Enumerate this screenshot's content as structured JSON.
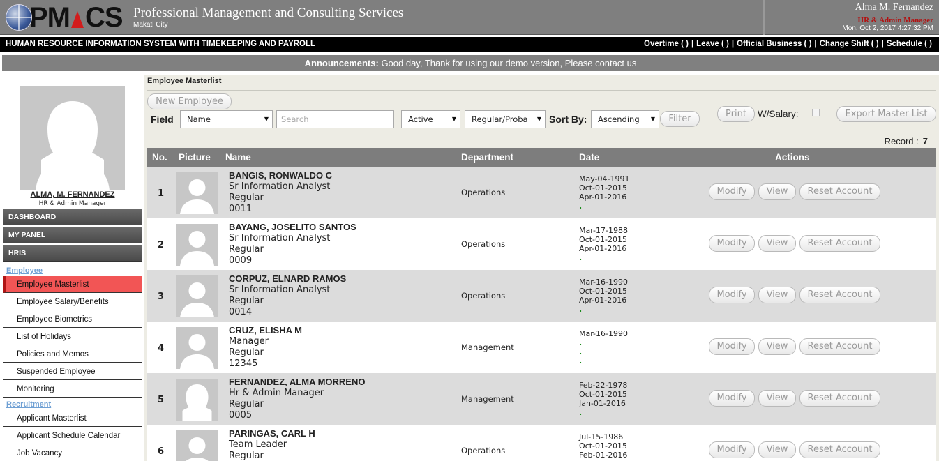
{
  "header": {
    "company_name": "Professional Management and Consulting Services",
    "city": "Makati City",
    "logo_left": "PM",
    "logo_right": "CS",
    "user_name": "Alma M. Fernandez",
    "user_role": "HR & Admin Manager",
    "datetime": "Mon, Oct 2, 2017 4:27:32 PM"
  },
  "topnav": {
    "system_title": "HUMAN RESOURCE INFORMATION SYSTEM WITH TIMEKEEPING AND PAYROLL",
    "links": [
      "Overtime ( )",
      "Leave ( )",
      "Official Business ( )",
      "Change Shift ( )",
      "Schedule ( )"
    ],
    "separator": "|"
  },
  "announcement": {
    "label": "Announcements:",
    "text": "Good day, Thank for using our demo version, Please contact us"
  },
  "sidebar": {
    "profile_name": "ALMA, M. FERNANDEZ",
    "profile_role": "HR & Admin Manager",
    "menus": [
      "DASHBOARD",
      "MY PANEL",
      "HRIS"
    ],
    "sections": {
      "employee": "Employee",
      "recruitment": "Recruitment"
    },
    "employee_items": [
      "Employee Masterlist",
      "Employee Salary/Benefits",
      "Employee Biometrics",
      "List of Holidays",
      "Policies and Memos",
      "Suspended Employee",
      "Monitoring"
    ],
    "recruitment_items": [
      "Applicant Masterlist",
      "Applicant Schedule Calendar",
      "Job Vacancy"
    ]
  },
  "main": {
    "breadcrumb": "Employee Masterlist",
    "new_employee": "New Employee",
    "field_label": "Field",
    "field_select": "Name",
    "search_placeholder": "Search",
    "status_select": "Active",
    "type_select": "Regular/Proba",
    "sort_label": "Sort By:",
    "sort_select": "Ascending",
    "filter": "Filter",
    "print": "Print",
    "w_salary": "W/Salary:",
    "export": "Export Master List",
    "record_label": "Record :",
    "record_count": "7"
  },
  "table": {
    "headers": [
      "No.",
      "Picture",
      "Name",
      "Department",
      "Date",
      "Actions"
    ],
    "actions": [
      "Modify",
      "View",
      "Reset Account"
    ],
    "rows": [
      {
        "no": "1",
        "name": "BANGIS, RONWALDO C",
        "position": "Sr Information Analyst",
        "status": "Regular",
        "id": "0011",
        "department": "Operations",
        "dates": [
          "May-04-1991",
          "Oct-01-2015",
          "Apr-01-2016",
          "."
        ]
      },
      {
        "no": "2",
        "name": "BAYANG, JOSELITO SANTOS",
        "position": "Sr Information Analyst",
        "status": "Regular",
        "id": "0009",
        "department": "Operations",
        "dates": [
          "Mar-17-1988",
          "Oct-01-2015",
          "Apr-01-2016",
          "."
        ]
      },
      {
        "no": "3",
        "name": "CORPUZ, ELNARD RAMOS",
        "position": "Sr Information Analyst",
        "status": "Regular",
        "id": "0014",
        "department": "Operations",
        "dates": [
          "Mar-16-1990",
          "Oct-01-2015",
          "Apr-01-2016",
          "."
        ]
      },
      {
        "no": "4",
        "name": "CRUZ, ELISHA M",
        "position": "Manager",
        "status": "Regular",
        "id": "12345",
        "department": "Management",
        "dates": [
          "Mar-16-1990",
          ".",
          ".",
          "."
        ]
      },
      {
        "no": "5",
        "name": "FERNANDEZ, ALMA MORRENO",
        "position": "Hr & Admin Manager",
        "status": "Regular",
        "id": "0005",
        "department": "Management",
        "dates": [
          "Feb-22-1978",
          "Oct-01-2015",
          "Jan-01-2016",
          "."
        ]
      },
      {
        "no": "6",
        "name": "PARINGAS, CARL H",
        "position": "Team Leader",
        "status": "Regular",
        "id": "",
        "department": "Operations",
        "dates": [
          "Jul-15-1986",
          "Oct-01-2015",
          "Feb-01-2016",
          ""
        ]
      }
    ]
  },
  "colors": {
    "header_bg": "#7f7f7f",
    "nav_bg": "#000000",
    "active_menu": "#f25555",
    "role_red": "#b31010",
    "row_shade": "#dcdcdc"
  }
}
